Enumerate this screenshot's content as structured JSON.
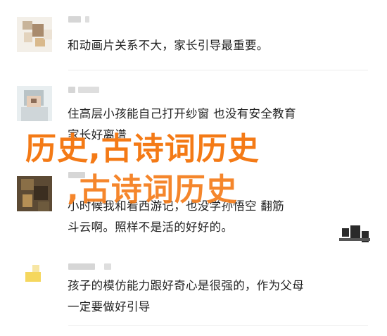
{
  "comments": [
    {
      "text": "和动画片关系不大，家长引导最重要。"
    },
    {
      "text": "住高层小孩能自己打开纱窗 也没有安全教育\n家长好离谱"
    },
    {
      "text": "小时候我和看西游记，也没学孙悟空  翻筋\n斗云啊。照样不是活的好好的。"
    },
    {
      "text": "孩子的模仿能力跟好奇心是很强的，作为父母\n一定要做好引导"
    }
  ],
  "overlay": {
    "line1": "历史,古诗词历史",
    "line2": ",古诗词历史"
  },
  "colors": {
    "overlay": "#f47a16",
    "divider": "#ececec",
    "text": "#222222"
  }
}
